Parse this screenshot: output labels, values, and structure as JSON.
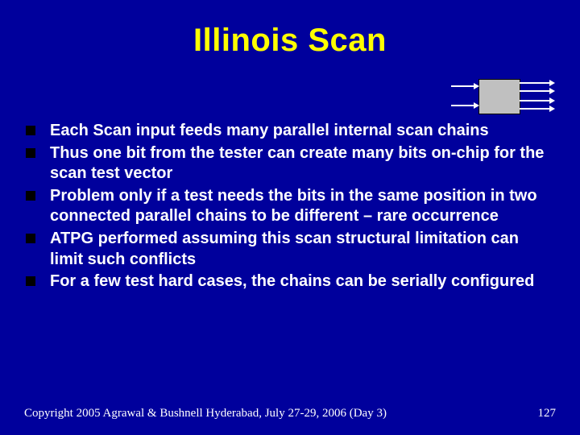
{
  "title": "Illinois Scan",
  "bullets": [
    "Each Scan input feeds many parallel internal scan chains",
    "Thus one bit from the tester can create many bits on-chip for the scan test vector",
    "Problem only if a test needs the bits in the same position in two connected parallel chains to be different – rare occurrence",
    "ATPG performed assuming this scan structural limitation can limit such conflicts",
    "For a few test hard cases, the chains can be serially configured"
  ],
  "footer": {
    "copyright": "Copyright 2005 Agrawal & Bushnell   Hyderabad, July 27-29, 2006 (Day 3)",
    "page": "127"
  }
}
